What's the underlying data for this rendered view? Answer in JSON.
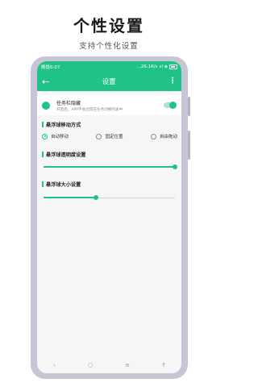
{
  "promo": {
    "title": "个性设置",
    "subtitle": "支持个性化设置"
  },
  "statusbar": {
    "time": "晚饭6:07",
    "network": "...26.1K/s",
    "signal": "ııl ◈"
  },
  "appbar": {
    "back_glyph": "←",
    "title": "设置",
    "more_glyph": "⋮"
  },
  "taskbar_card": {
    "title": "任务栏隐藏",
    "description": "开启后，APP不会出现在任务切换列表中",
    "enabled": true
  },
  "move_section": {
    "header": "悬浮球移动方式",
    "options": [
      "自动移动",
      "固定位置",
      "自由拖动"
    ],
    "selected_index": 0
  },
  "opacity_section": {
    "header": "悬浮球透明度设置",
    "value_percent": 100
  },
  "size_section": {
    "header": "悬浮球大小设置",
    "value_percent": 40
  },
  "navbar": {
    "back": "‹",
    "home": "○",
    "menu": "≡",
    "assist": "☨"
  },
  "colors": {
    "accent": "#1fc388",
    "phone_frame": "#c5c5d6"
  }
}
